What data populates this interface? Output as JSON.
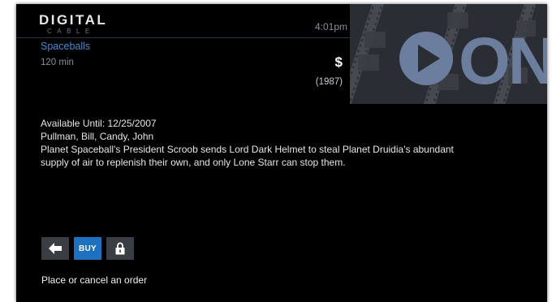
{
  "header": {
    "brand": "DIGITAL",
    "brand_sub": "CABLE",
    "time": "4:01pm",
    "banner_text": "ON",
    "banner_icon": "play-icon"
  },
  "program": {
    "title": "Spaceballs",
    "duration": "120 min",
    "price": "$",
    "year": "(1987)",
    "available_until": "Available Until: 12/25/2007",
    "cast": "Pullman, Bill, Candy, John",
    "synopsis_line1": "Planet Spaceball's President Scroob sends Lord Dark Helmet to steal Planet Druidia's abundant",
    "synopsis_line2": "supply of air to replenish their own, and only Lone Starr can stop them."
  },
  "actions": {
    "back_icon": "left-arrow-icon",
    "buy_label": "BUY",
    "lock_icon": "lock-icon"
  },
  "status": {
    "message": "Place or cancel an order"
  },
  "colors": {
    "background": "#000000",
    "accent": "#1c72c0",
    "title": "#3a8edb",
    "button": "#3a3d43"
  }
}
